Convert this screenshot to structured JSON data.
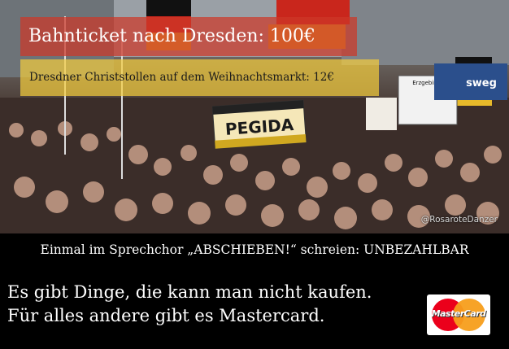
{
  "meme": {
    "line1": "Bahnticket nach Dresden: 100€",
    "line2": "Dresdner Christstollen auf dem Weihnachtsmarkt: 12€",
    "line3": "Einmal im Sprechchor „ABSCHIEBEN!“ schreien: UNBEZAHLBAR",
    "tagline_1": "Es gibt Dinge, die kann man nicht kaufen.",
    "tagline_2": "Für alles andere gibt es Mastercard."
  },
  "photo": {
    "banner_text": "PEGIDA",
    "sign_text_1": "Erzgebirge",
    "sign_text_2": "sweg",
    "watermark": "@RosaroteDanzer"
  },
  "logo": {
    "text": "MasterCard",
    "colors": {
      "red": "#eb001b",
      "orange": "#f79e1b"
    }
  }
}
